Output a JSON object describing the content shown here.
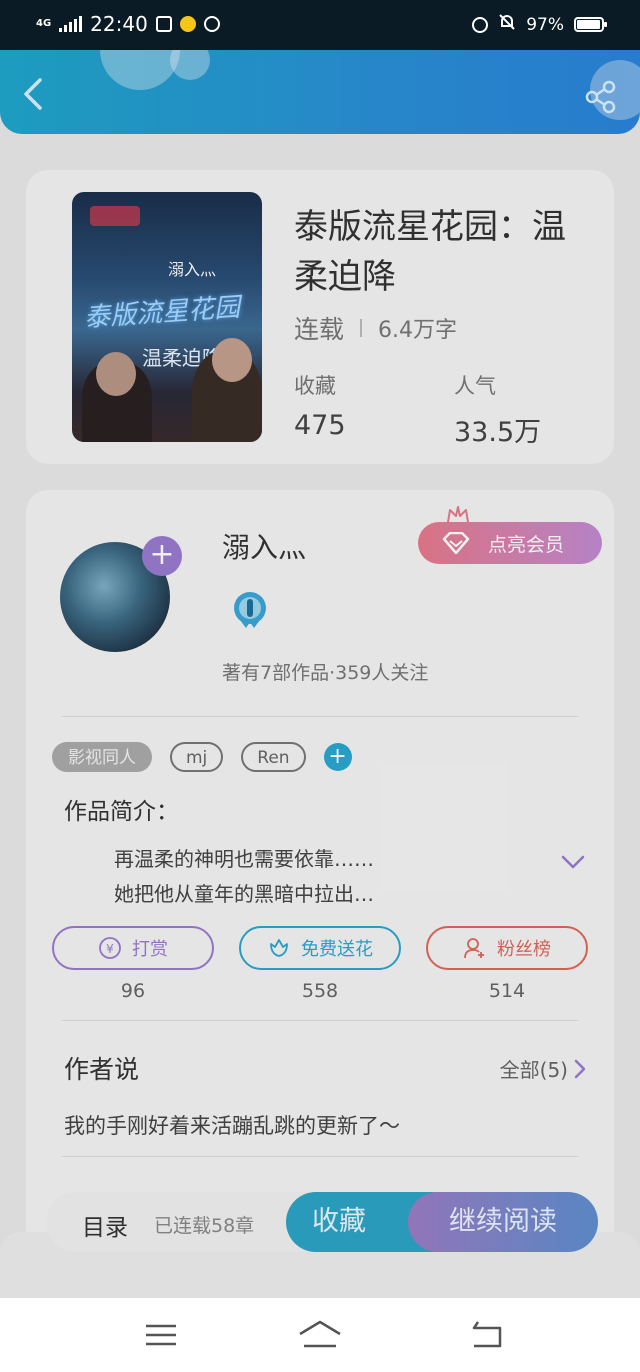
{
  "status_bar": {
    "network": "4G",
    "time": "22:40",
    "battery": "97%"
  },
  "header": {
    "back_icon": "chevron-left-icon",
    "share_icon": "share-icon",
    "color": "#2a8fd6"
  },
  "book": {
    "cover_title_line1": "泰版流星花园",
    "cover_title_line2": "温柔迫降",
    "cover_author": "溺入灬",
    "title": "泰版流星花园：温柔迫降",
    "status": "连载",
    "word_count": "6.4万字",
    "stats": [
      {
        "label": "收藏",
        "value": "475"
      },
      {
        "label": "人气",
        "value": "33.5万"
      }
    ]
  },
  "author": {
    "name": "溺入灬",
    "vip_button": "点亮会员",
    "summary": "著有7部作品·359人关注",
    "tags": [
      "影视同人",
      "mj",
      "Ren"
    ]
  },
  "intro": {
    "label": "作品简介：",
    "line1": "再温柔的神明也需要依靠……",
    "line2": "她把他从童年的黑暗中拉出…"
  },
  "actions": [
    {
      "label": "打赏",
      "count": "96",
      "color": "#9a7bd0",
      "icon": "yuan-coin-icon"
    },
    {
      "label": "免费送花",
      "count": "558",
      "color": "#2aa7d0",
      "icon": "flower-icon"
    },
    {
      "label": "粉丝榜",
      "count": "514",
      "color": "#e0685a",
      "icon": "fan-rank-icon"
    }
  ],
  "author_say": {
    "label": "作者说",
    "all_label": "全部(5)",
    "text": "我的手刚好着来活蹦乱跳的更新了～"
  },
  "bottom_bar": {
    "toc": "目录",
    "chapters": "已连载58章",
    "favorite": "收藏",
    "continue": "继续阅读"
  }
}
